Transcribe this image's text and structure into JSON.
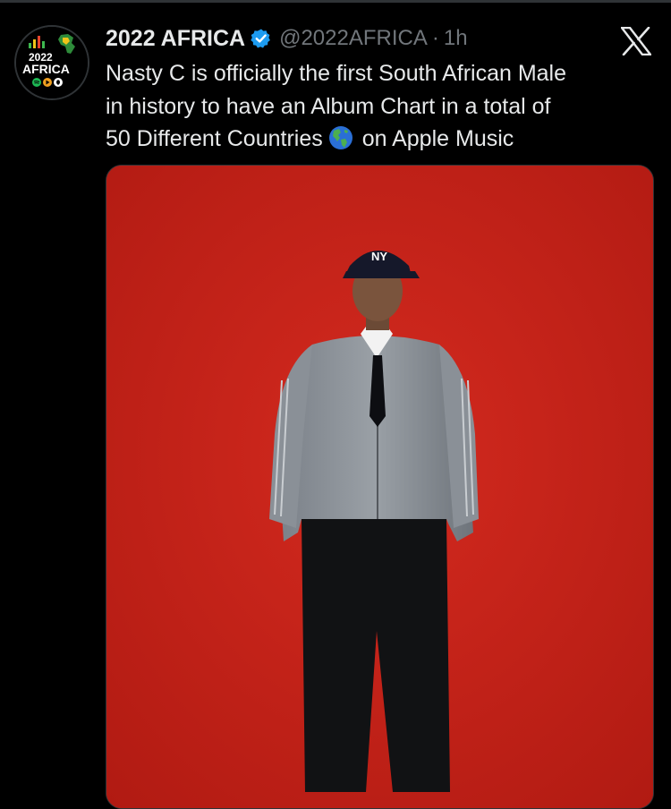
{
  "tweet": {
    "author": {
      "display_name": "2022 AFRICA",
      "handle": "@2022AFRICA",
      "verified": true,
      "avatar_text_top": "2022",
      "avatar_text_bottom": "AFRICA"
    },
    "separator": "·",
    "time": "1h",
    "text_lines": [
      "Nasty C is officially the first South African Male",
      "in history to have an Album Chart in a total of",
      "50 Different Countries",
      "on Apple Music"
    ],
    "emoji": "globe-americas-icon",
    "media": {
      "type": "photo",
      "cap_logo": "NY"
    }
  },
  "brand": {
    "icon": "x-logo-icon"
  },
  "colors": {
    "background": "#000000",
    "text_primary": "#e7e9ea",
    "text_secondary": "#71767b",
    "verified_blue": "#1d9bf0",
    "photo_backdrop": "#c11f17"
  }
}
